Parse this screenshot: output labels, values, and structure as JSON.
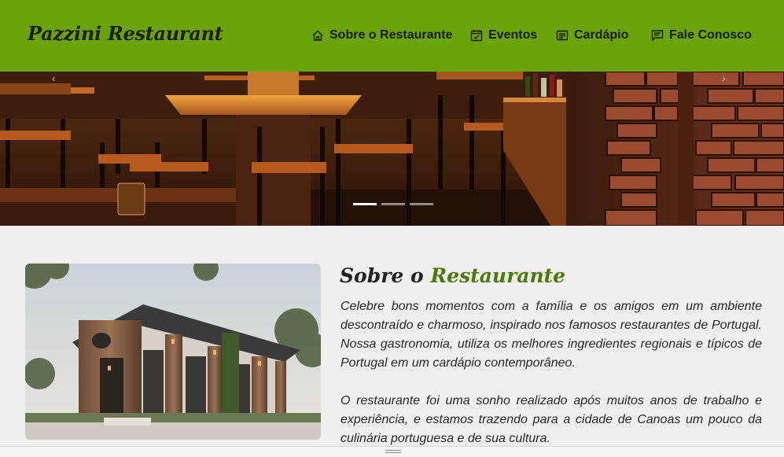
{
  "brand": {
    "name": "Pazzini Restaurant"
  },
  "nav": {
    "items": [
      {
        "label": "Sobre o Restaurante",
        "icon": "home-icon"
      },
      {
        "label": "Eventos",
        "icon": "calendar-icon"
      },
      {
        "label": "Cardápio",
        "icon": "menu-card-icon"
      },
      {
        "label": "Fale Conosco",
        "icon": "chat-icon"
      }
    ]
  },
  "hero": {
    "slide_count": 3,
    "active_slide": 1
  },
  "about": {
    "title_prefix": "Sobre o",
    "title_accent": "Restaurante",
    "paragraph_1": "Celebre bons momentos com a família e os amigos em um ambiente descontraído e charmoso, inspirado nos famosos restaurantes de Portugal. Nossa gastronomia, utiliza os melhores ingredientes regionais e típicos de Portugal em um cardápio contemporâneo.",
    "paragraph_2": "O restaurante foi uma sonho realizado após muitos anos de trabalho e experiência, e estamos trazendo para a cidade de Canoas um pouco da culinária portuguesa e de sua cultura."
  },
  "colors": {
    "navbar_bg": "#6aa30a",
    "accent_green": "#4b7a0a",
    "page_bg": "#efefef",
    "text_dark": "#262626"
  }
}
